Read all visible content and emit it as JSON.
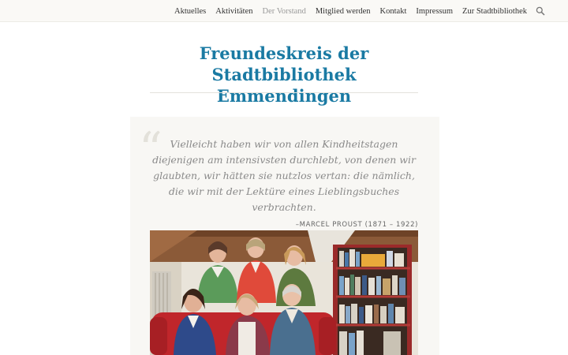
{
  "nav": {
    "items": [
      {
        "label": "Aktuelles"
      },
      {
        "label": "Aktivitäten"
      },
      {
        "label": "Der Vorstand",
        "current": true
      },
      {
        "label": "Mitglied werden"
      },
      {
        "label": "Kontakt"
      },
      {
        "label": "Impressum"
      },
      {
        "label": "Zur Stadtbibliothek"
      }
    ],
    "search_icon": "search-icon"
  },
  "site": {
    "title_line1": "Freundeskreis der Stadtbibliothek",
    "title_line2": "Emmendingen"
  },
  "quote": {
    "text": "Vielleicht haben wir von allen Kindheitstagen diejenigen am intensivsten durchlebt, von denen wir glaubten, wir hätten sie nutzlos vertan: die nämlich, die wir mit der Lektüre eines Lieblingsbuches verbrachten.",
    "author": "–Marcel Proust (1871 – 1922)"
  },
  "colors": {
    "accent": "#1a7aa3",
    "quote_bg": "#f8f7f4",
    "topbar_bg": "#faf9f6"
  }
}
